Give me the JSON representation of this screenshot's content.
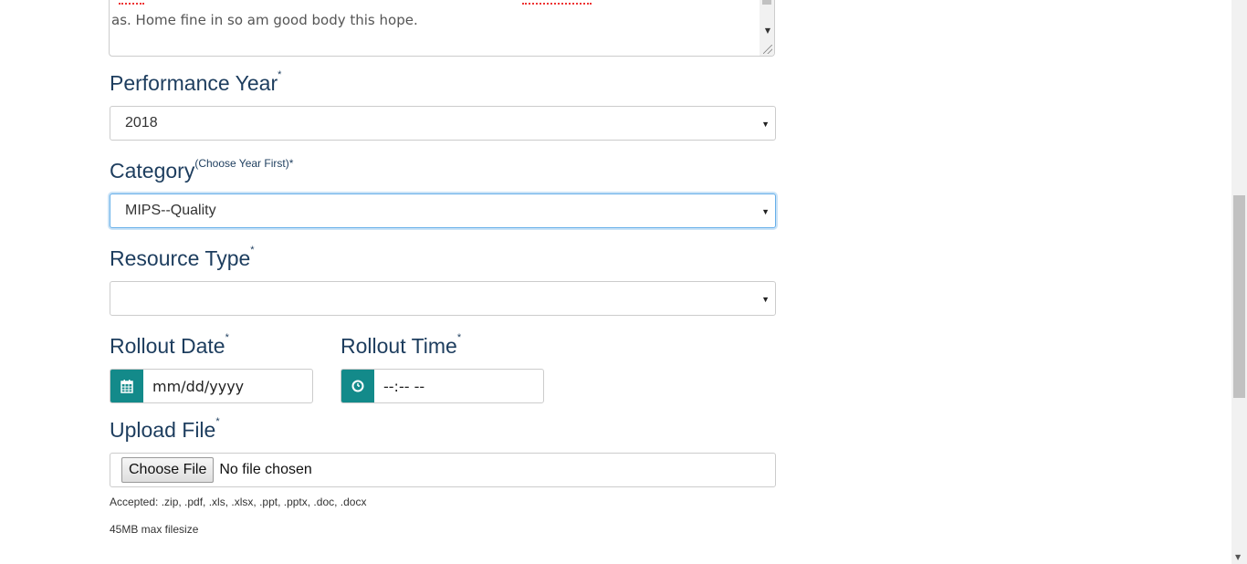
{
  "description_field": {
    "text": "as. Home fine in so am good body this hope."
  },
  "performance_year": {
    "label": "Performance Year",
    "required": "*",
    "selected": "2018"
  },
  "category": {
    "label": "Category",
    "hint": "(Choose Year First)*",
    "selected": "MIPS--Quality"
  },
  "resource_type": {
    "label": "Resource Type",
    "required": "*",
    "selected": ""
  },
  "rollout_date": {
    "label": "Rollout Date",
    "required": "*",
    "placeholder": "mm/dd/yyyy",
    "icon": "calendar-icon"
  },
  "rollout_time": {
    "label": "Rollout Time",
    "required": "*",
    "placeholder": "--:-- --",
    "icon": "clock-icon"
  },
  "upload_file": {
    "label": "Upload File",
    "required": "*",
    "button_label": "Choose File",
    "status": "No file chosen",
    "accepted": "Accepted: .zip, .pdf, .xls, .xlsx, .ppt, .pptx, .doc, .docx",
    "max_size": "45MB max filesize"
  },
  "colors": {
    "label": "#1d3d5e",
    "addon": "#138a8a",
    "focus": "#66afe9"
  }
}
